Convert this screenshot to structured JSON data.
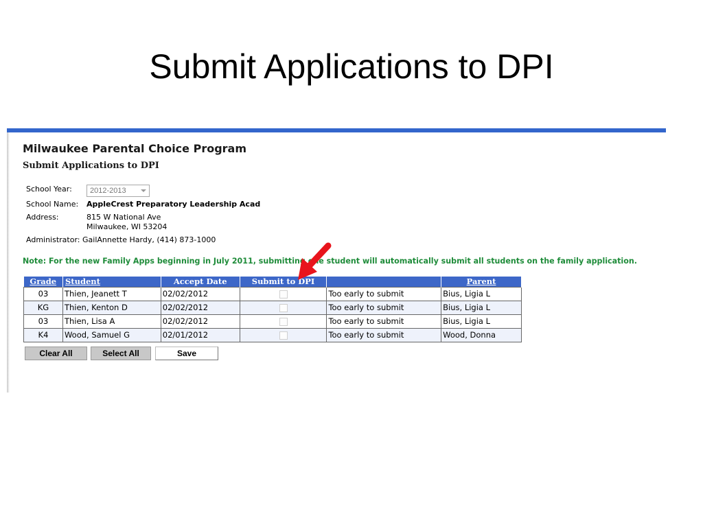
{
  "slide": {
    "title": "Submit Applications to DPI"
  },
  "app": {
    "program_title": "Milwaukee Parental Choice Program",
    "page_subtitle": "Submit Applications to DPI",
    "school_year_label": "School Year:",
    "school_year_value": "2012-2013",
    "school_name_label": "School Name:",
    "school_name_value": "AppleCrest Preparatory Leadership Acad",
    "address_label": "Address:",
    "address_line1": "815 W National Ave",
    "address_line2": "Milwaukee, WI 53204",
    "administrator_label": "Administrator:",
    "administrator_value": "GailAnnette Hardy, (414) 873-1000",
    "note": "Note: For the new Family Apps beginning in July 2011, submitting one student will automatically submit all students on the family application."
  },
  "table": {
    "headers": {
      "grade": "Grade",
      "student": "Student",
      "accept_date": "Accept Date",
      "submit": "Submit to DPI",
      "status": "",
      "parent": "Parent"
    },
    "rows": [
      {
        "grade": "03",
        "student": "Thien, Jeanett T",
        "accept_date": "02/02/2012",
        "status": "Too early to submit",
        "parent": "Bius, Ligia L"
      },
      {
        "grade": "KG",
        "student": "Thien, Kenton D",
        "accept_date": "02/02/2012",
        "status": "Too early to submit",
        "parent": "Bius, Ligia L"
      },
      {
        "grade": "03",
        "student": "Thien, Lisa A",
        "accept_date": "02/02/2012",
        "status": "Too early to submit",
        "parent": "Bius, Ligia L"
      },
      {
        "grade": "K4",
        "student": "Wood, Samuel G",
        "accept_date": "02/01/2012",
        "status": "Too early to submit",
        "parent": "Wood, Donna"
      }
    ]
  },
  "buttons": {
    "clear_all": "Clear All",
    "select_all": "Select All",
    "save": "Save"
  },
  "colors": {
    "header_blue": "#3d67c8",
    "top_bar": "#3366cc",
    "note_green": "#1f8c3a",
    "arrow_red": "#e8141c"
  },
  "icons": {
    "annotation": "red-arrow-icon",
    "dropdown": "chevron-down-icon"
  }
}
